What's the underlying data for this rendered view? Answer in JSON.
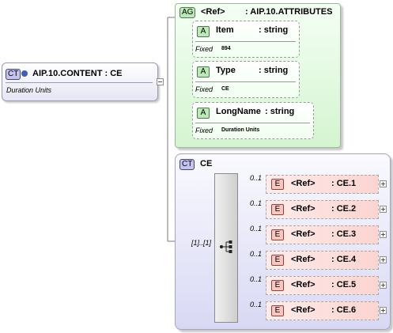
{
  "root": {
    "badge": "CT",
    "name": "AIP.10.CONTENT : CE",
    "desc": "Duration Units"
  },
  "attr_group": {
    "badge": "AG",
    "ref": "<Ref>",
    "name": ": AIP.10.ATTRIBUTES"
  },
  "attributes": [
    {
      "badge": "A",
      "name": "Item",
      "type": ": string",
      "fixed_label": "Fixed",
      "fixed_value": "894"
    },
    {
      "badge": "A",
      "name": "Type",
      "type": ": string",
      "fixed_label": "Fixed",
      "fixed_value": "CE"
    },
    {
      "badge": "A",
      "name": "LongName",
      "type": ": string",
      "fixed_label": "Fixed",
      "fixed_value": "Duration Units"
    }
  ],
  "complex_type": {
    "badge": "CT",
    "name": "CE",
    "occurrence": "[1]..[1]"
  },
  "elements": [
    {
      "occurrence": "0..1",
      "badge": "E",
      "ref": "<Ref>",
      "name": ": CE.1"
    },
    {
      "occurrence": "0..1",
      "badge": "E",
      "ref": "<Ref>",
      "name": ": CE.2"
    },
    {
      "occurrence": "0..1",
      "badge": "E",
      "ref": "<Ref>",
      "name": ": CE.3"
    },
    {
      "occurrence": "0..1",
      "badge": "E",
      "ref": "<Ref>",
      "name": ": CE.4"
    },
    {
      "occurrence": "0..1",
      "badge": "E",
      "ref": "<Ref>",
      "name": ": CE.5"
    },
    {
      "occurrence": "0..1",
      "badge": "E",
      "ref": "<Ref>",
      "name": ": CE.6"
    }
  ]
}
